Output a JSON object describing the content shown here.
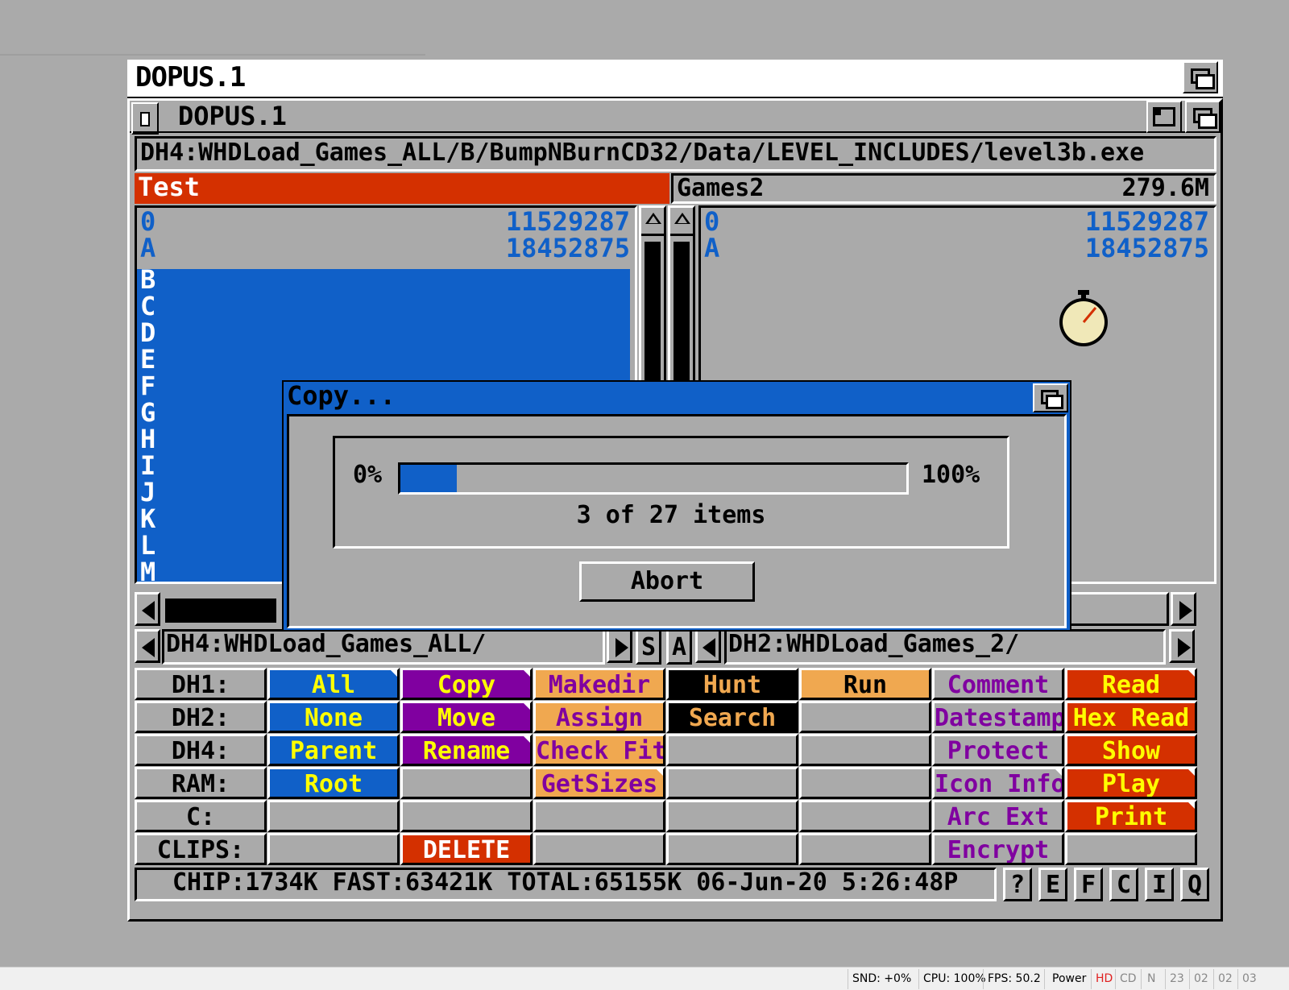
{
  "screen": {
    "title": "DOPUS.1"
  },
  "window": {
    "title": "DOPUS.1"
  },
  "path": "DH4:WHDLoad_Games_ALL/B/BumpNBurnCD32/Data/LEVEL_INCLUDES/level3b.exe",
  "left_lister": {
    "name": "Test",
    "rows": [
      {
        "name": "0",
        "size": "11529287"
      },
      {
        "name": "A",
        "size": "18452875"
      }
    ],
    "selected": [
      "B",
      "C",
      "D",
      "E",
      "F",
      "G",
      "H",
      "I",
      "J",
      "K",
      "L",
      "M"
    ],
    "path": "DH4:WHDLoad_Games_ALL/"
  },
  "right_lister": {
    "name": "Games2",
    "free": "279.6M",
    "rows": [
      {
        "name": "0",
        "size": "11529287"
      },
      {
        "name": "A",
        "size": "18452875"
      }
    ],
    "path": "DH2:WHDLoad_Games_2/"
  },
  "mid_buttons": {
    "s": "S",
    "a": "A"
  },
  "dialog": {
    "title": "Copy...",
    "min_label": "0%",
    "max_label": "100%",
    "progress_fraction": 0.111,
    "count_text": "3 of 27 items",
    "abort_label": "Abort"
  },
  "colors": {
    "gray": "#aaaaaa",
    "blue": "#1060c8",
    "purple": "#8000a0",
    "orange": "#f0a850",
    "red": "#d43000",
    "black": "#000000",
    "yellow": "#ffff00"
  },
  "buttons": {
    "devices": [
      "DH1:",
      "DH2:",
      "DH4:",
      "RAM:",
      "C:",
      "CLIPS:"
    ],
    "col1": [
      "All",
      "None",
      "Parent",
      "Root",
      "",
      ""
    ],
    "col2": [
      "Copy",
      "Move",
      "Rename",
      "",
      "",
      "DELETE"
    ],
    "col3": [
      "Makedir",
      "Assign",
      "Check Fit",
      "GetSizes",
      "",
      ""
    ],
    "col4": [
      "Hunt",
      "Search",
      "",
      "",
      "",
      ""
    ],
    "col5": [
      "Run",
      "",
      "",
      "",
      "",
      ""
    ],
    "col6": [
      "Comment",
      "Datestamp",
      "Protect",
      "Icon Info",
      "Arc Ext",
      "Encrypt"
    ],
    "col7": [
      "Read",
      "Hex Read",
      "Show",
      "Play",
      "Print",
      ""
    ]
  },
  "status": {
    "text": "CHIP:1734K  FAST:63421K  TOTAL:65155K  06-Jun-20   5:26:48P",
    "buttons": [
      "?",
      "E",
      "F",
      "C",
      "I",
      "Q"
    ]
  },
  "host_bar": {
    "snd": "SND: +0%",
    "cpu": "CPU: 100%",
    "fps": "FPS: 50.2",
    "power": "Power",
    "hd": "HD",
    "cd": "CD",
    "n": "N",
    "d0": "23",
    "d1": "02",
    "d2": "02",
    "d3": "03"
  }
}
